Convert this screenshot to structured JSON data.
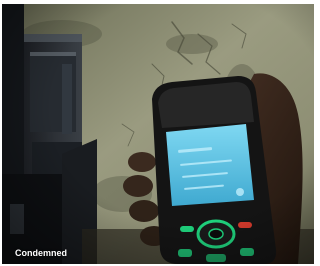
{
  "image": {
    "caption": "Condemned",
    "scene": "hand-holding-mobile-phone"
  },
  "colors": {
    "wall": "#8d8e74",
    "screen": "#5fc7e6",
    "keypad_accent": "#1fd07c",
    "caption_text": "#ffffff"
  }
}
